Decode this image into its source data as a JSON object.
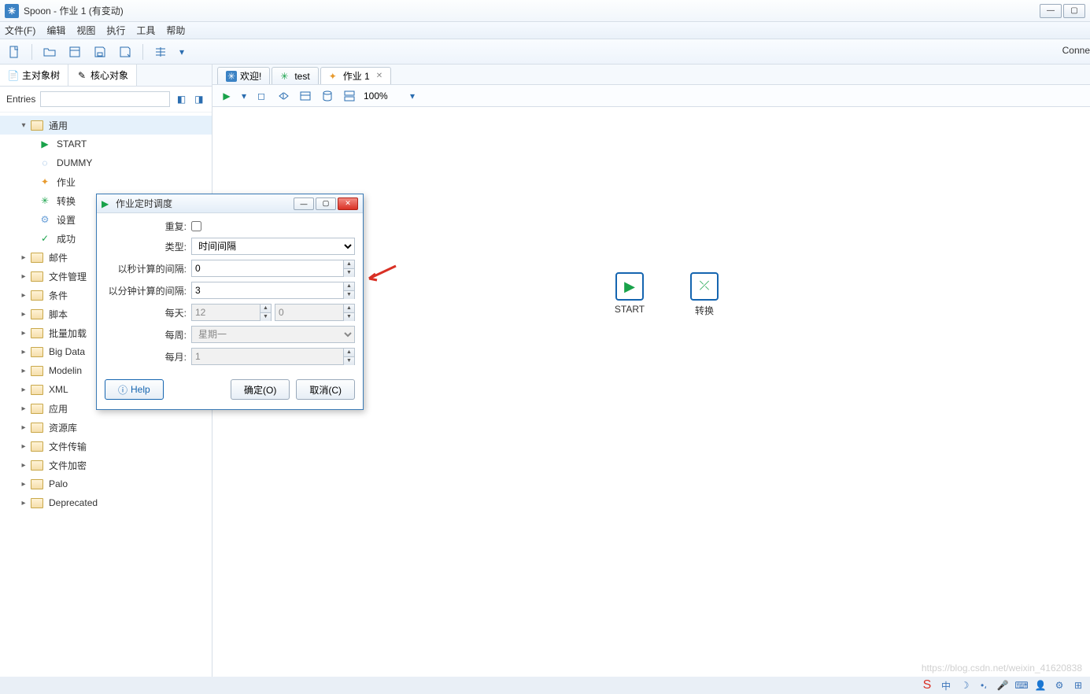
{
  "window": {
    "title": "Spoon - 作业 1 (有变动)"
  },
  "menu": [
    "文件(F)",
    "编辑",
    "视图",
    "执行",
    "工具",
    "帮助"
  ],
  "conn_label": "Conne",
  "side": {
    "tab1": "主对象树",
    "tab2": "核心对象",
    "entries_label": "Entries",
    "root": "通用",
    "leaf": {
      "start": "START",
      "dummy": "DUMMY",
      "job": "作业",
      "trans": "转换",
      "set": "设置",
      "ok": "成功"
    },
    "folders": [
      "邮件",
      "文件管理",
      "条件",
      "脚本",
      "批量加载",
      "Big Data",
      "Modelin",
      "XML",
      "应用",
      "资源库",
      "文件传输",
      "文件加密",
      "Palo",
      "Deprecated"
    ]
  },
  "tabs": {
    "welcome": "欢迎!",
    "test": "test",
    "job": "作业 1"
  },
  "zoom": "100%",
  "canvas": {
    "start": "START",
    "trans": "转换"
  },
  "dialog": {
    "title": "作业定时调度",
    "lbl_repeat": "重复:",
    "lbl_type": "类型:",
    "type_val": "时间间隔",
    "lbl_sec": "以秒计算的间隔:",
    "sec_val": "0",
    "lbl_min": "以分钟计算的间隔:",
    "min_val": "3",
    "lbl_day": "每天:",
    "day_h": "12",
    "day_m": "0",
    "lbl_week": "每周:",
    "week_val": "星期一",
    "lbl_month": "每月:",
    "month_val": "1",
    "help": "Help",
    "ok": "确定(O)",
    "cancel": "取消(C)"
  },
  "watermark": "https://blog.csdn.net/weixin_41620838"
}
